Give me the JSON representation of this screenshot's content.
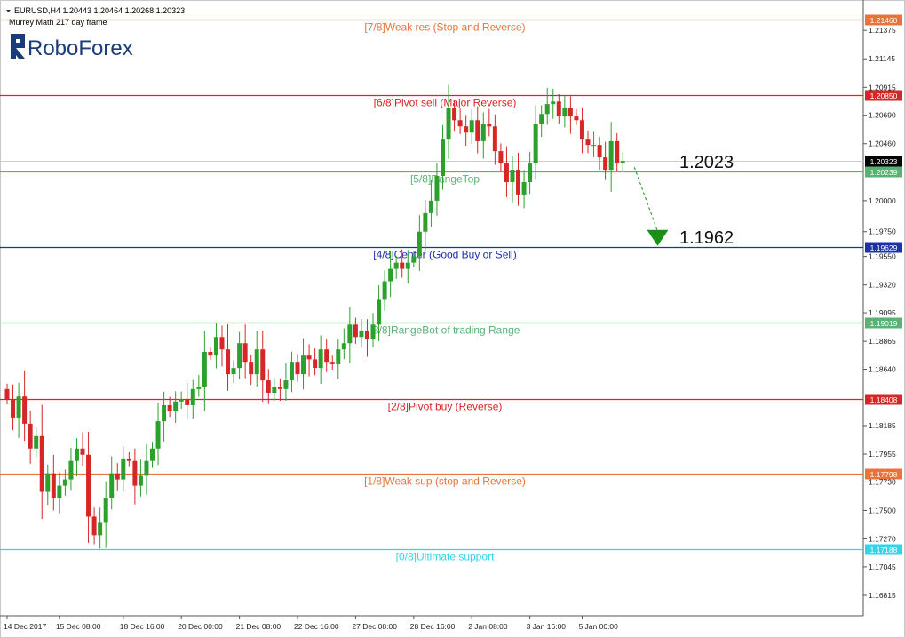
{
  "header": {
    "symbol_line": "EURUSD,H4  1.20443 1.20464 1.20268 1.20323",
    "subtitle": "Murrey Math 217 day frame"
  },
  "logo": {
    "text": "RoboForex"
  },
  "chart_data": {
    "type": "candlestick",
    "ylim": [
      1.1665,
      1.2162
    ],
    "y_ticks": [
      "1.21375",
      "1.21145",
      "1.20915",
      "1.20690",
      "1.20460",
      "1.20000",
      "1.19750",
      "1.19550",
      "1.19320",
      "1.19095",
      "1.18865",
      "1.18640",
      "1.18185",
      "1.17955",
      "1.17730",
      "1.17500",
      "1.17270",
      "1.17045",
      "1.16815"
    ],
    "x_ticks": [
      {
        "label": "14 Dec 2017",
        "index": 0
      },
      {
        "label": "15 Dec 08:00",
        "index": 9
      },
      {
        "label": "18 Dec 16:00",
        "index": 20
      },
      {
        "label": "20 Dec 00:00",
        "index": 30
      },
      {
        "label": "21 Dec 08:00",
        "index": 40
      },
      {
        "label": "22 Dec 16:00",
        "index": 50
      },
      {
        "label": "27 Dec 08:00",
        "index": 60
      },
      {
        "label": "28 Dec 16:00",
        "index": 70
      },
      {
        "label": "2 Jan 08:00",
        "index": 80
      },
      {
        "label": "3 Jan 16:00",
        "index": 90
      },
      {
        "label": "5 Jan 00:00",
        "index": 99
      }
    ],
    "levels": [
      {
        "label": "[7/8]Weak res (Stop and Reverse)",
        "value": 1.2146,
        "tag": "1.21460",
        "color": "#e8743b"
      },
      {
        "label": "[6/8]Pivot sell (Major Reverse)",
        "value": 1.2085,
        "tag": "1.20850",
        "color": "#d62728"
      },
      {
        "label": "[5/8]RangeTop",
        "value": 1.20239,
        "tag": "1.20239",
        "color": "#5bb174"
      },
      {
        "label": "[4/8]Center (Good Buy or Sell)",
        "value": 1.19629,
        "tag": "1.19629",
        "color": "#1f2fa8"
      },
      {
        "label": "[3/8]RangeBot of trading Range",
        "value": 1.19019,
        "tag": "1.19019",
        "color": "#5bb174"
      },
      {
        "label": "[2/8]Pivot buy (Reverse)",
        "value": 1.184,
        "tag": "1.18408",
        "color": "#d62728"
      },
      {
        "label": "[1/8]Weak sup (stop and Reverse)",
        "value": 1.17798,
        "tag": "1.17798",
        "color": "#e8743b"
      },
      {
        "label": "[0/8]Ultimate support",
        "value": 1.17188,
        "tag": "1.17188",
        "color": "#33d4e8"
      }
    ],
    "current_price": {
      "value": 1.20323,
      "tag": "1.20323"
    },
    "annotations": [
      {
        "text": "1.2023",
        "value": 1.2023
      },
      {
        "text": "1.1962",
        "value": 1.1962
      }
    ],
    "forecast": {
      "from_index": 108,
      "from_value": 1.2027,
      "to_index": 112,
      "to_value": 1.1965
    },
    "colors": {
      "up": "#2ca02c",
      "down": "#d62728",
      "current_line": "#cccccc",
      "arrow": "#1a8f1a"
    },
    "closes": [
      1.184,
      1.1825,
      1.1842,
      1.182,
      1.18,
      1.181,
      1.1765,
      1.178,
      1.176,
      1.177,
      1.1775,
      1.179,
      1.18,
      1.1795,
      1.1745,
      1.173,
      1.174,
      1.176,
      1.178,
      1.1775,
      1.1792,
      1.179,
      1.177,
      1.1778,
      1.179,
      1.18,
      1.1822,
      1.1835,
      1.183,
      1.1838,
      1.184,
      1.1835,
      1.1848,
      1.185,
      1.1878,
      1.1875,
      1.189,
      1.188,
      1.186,
      1.1865,
      1.1885,
      1.187,
      1.186,
      1.188,
      1.1855,
      1.1845,
      1.185,
      1.1848,
      1.1855,
      1.187,
      1.186,
      1.1875,
      1.1872,
      1.1865,
      1.188,
      1.187,
      1.1868,
      1.188,
      1.1885,
      1.19,
      1.189,
      1.1895,
      1.1888,
      1.19,
      1.192,
      1.1935,
      1.1945,
      1.195,
      1.1945,
      1.195,
      1.1955,
      1.1975,
      1.199,
      1.2,
      1.202,
      1.205,
      1.2075,
      1.2065,
      1.206,
      1.2055,
      1.2065,
      1.2048,
      1.2062,
      1.206,
      1.204,
      1.203,
      1.2015,
      1.2025,
      1.2005,
      1.2015,
      1.203,
      1.2062,
      1.207,
      1.2078,
      1.208,
      1.2068,
      1.2075,
      1.2068,
      1.2065,
      1.205,
      1.2045,
      1.2045,
      1.2035,
      1.2025,
      1.2048,
      1.203,
      1.2032
    ],
    "open_first": 1.1848
  }
}
